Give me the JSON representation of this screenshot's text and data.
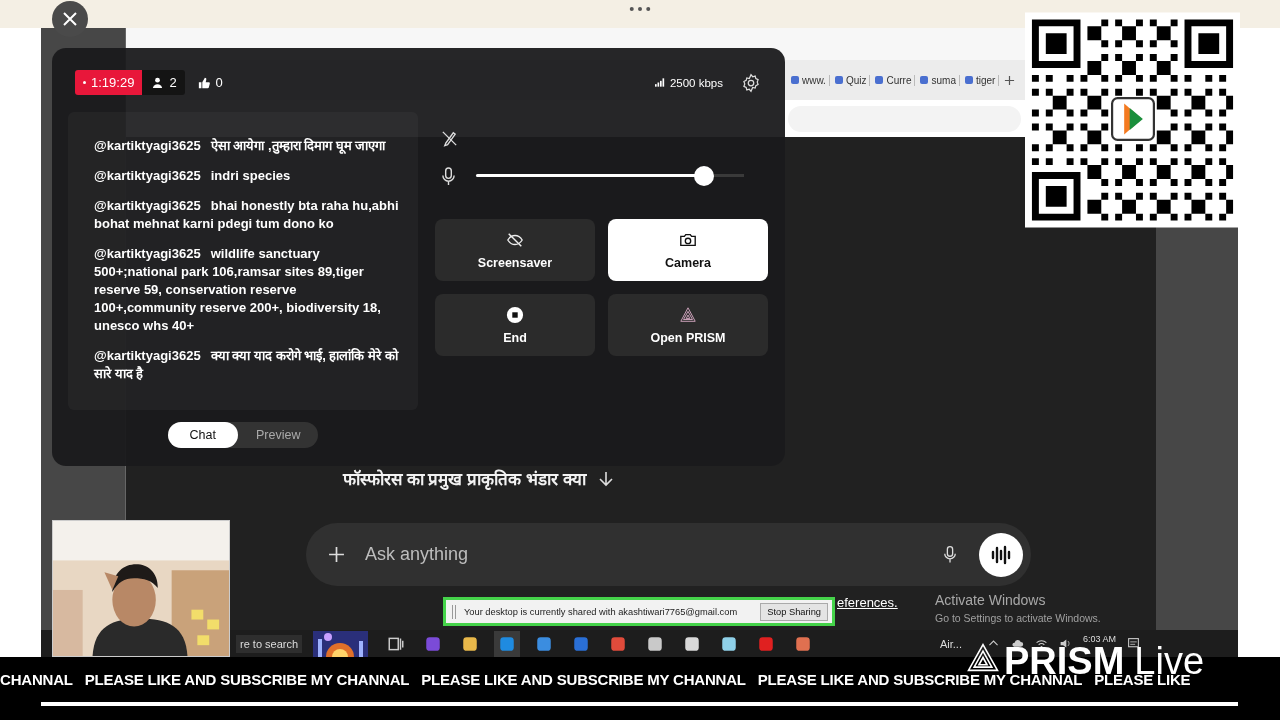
{
  "browser": {
    "tabs": [
      {
        "label": "www."
      },
      {
        "label": "Quiz"
      },
      {
        "label": "Curre"
      },
      {
        "label": "suma"
      },
      {
        "label": "tiger"
      }
    ],
    "question": "फॉस्फोरस का प्रमुख प्राकृतिक भंडार क्या",
    "prompt": {
      "placeholder": "Ask anything"
    },
    "references": "eferences."
  },
  "activation": {
    "title": "Activate Windows",
    "subtitle": "Go to Settings to activate Windows."
  },
  "share_banner": {
    "text": "Your desktop is currently shared with akashtiwari7765@gmail.com",
    "button": "Stop Sharing"
  },
  "taskbar": {
    "search": "re to search",
    "tray_app": "Air...",
    "time": "6:03 AM"
  },
  "stream_panel": {
    "live_time": "1:19:29",
    "viewers": "2",
    "likes": "0",
    "bitrate": "2500 kbps",
    "chat": [
      {
        "user": "@kartiktyagi3625",
        "text": "ऐसा आयेगा ,तुम्हारा दिमाग घूम जाएगा"
      },
      {
        "user": "@kartiktyagi3625",
        "text": "indri species"
      },
      {
        "user": "@kartiktyagi3625",
        "text": "bhai honestly bta raha hu,abhi bohat mehnat karni pdegi tum dono ko"
      },
      {
        "user": "@kartiktyagi3625",
        "text": "wildlife sanctuary 500+;national park 106,ramsar sites 89,tiger reserve 59, conservation reserve 100+,community reserve 200+, biodiversity 18, unesco whs 40+"
      },
      {
        "user": "@kartiktyagi3625",
        "text": "क्या क्या याद करोगे भाई, हालांकि मेरे को सारे याद है"
      }
    ],
    "view_tabs": [
      {
        "label": "Chat",
        "selected": true
      },
      {
        "label": "Preview",
        "selected": false
      }
    ],
    "mic": {
      "level": 0.85
    },
    "actions": [
      {
        "kind": "screensaver",
        "label": "Screensaver",
        "selected": false
      },
      {
        "kind": "camera",
        "label": "Camera",
        "selected": true
      },
      {
        "kind": "end",
        "label": "End",
        "selected": false
      },
      {
        "kind": "prism",
        "label": "Open PRISM",
        "selected": false
      }
    ]
  },
  "ticker": [
    "CHANNAL",
    "PLEASE LIKE AND SUBSCRIBE MY CHANNAL",
    "PLEASE LIKE AND SUBSCRIBE MY CHANNAL",
    "PLEASE LIKE AND SUBSCRIBE MY CHANNAL",
    "PLEASE LIKE"
  ],
  "logo": {
    "name": "PRISM",
    "suffix": "Live"
  }
}
